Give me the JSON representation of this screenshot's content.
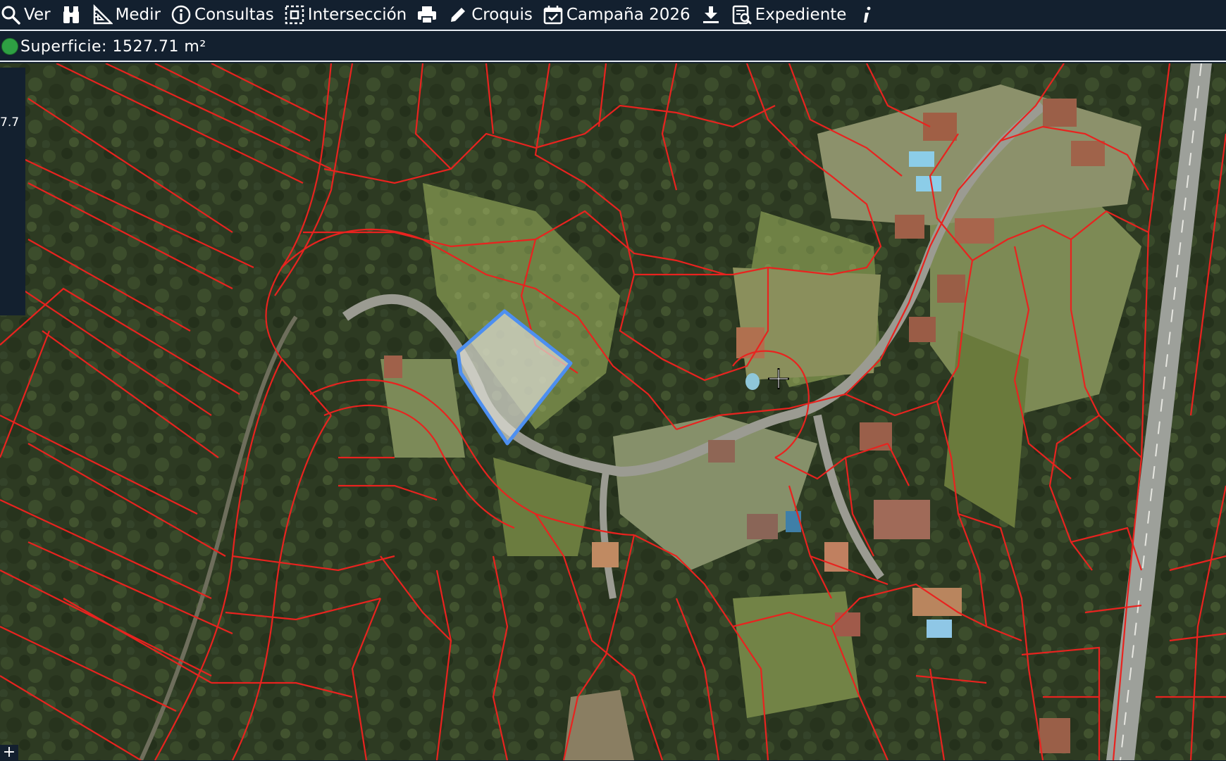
{
  "toolbar": {
    "items": [
      {
        "label": "Ver",
        "icon": "search-icon"
      },
      {
        "label": "",
        "icon": "binoculars-icon"
      },
      {
        "label": "Medir",
        "icon": "ruler-icon"
      },
      {
        "label": "Consultas",
        "icon": "info-icon"
      },
      {
        "label": "Intersección",
        "icon": "intersection-icon"
      },
      {
        "label": "",
        "icon": "printer-icon"
      },
      {
        "label": "Croquis",
        "icon": "pencil-icon"
      },
      {
        "label": "Campaña 2026",
        "icon": "calendar-check-icon"
      },
      {
        "label": "",
        "icon": "download-icon"
      },
      {
        "label": "Expediente",
        "icon": "document-search-icon"
      },
      {
        "label": "",
        "icon": "info-italic-icon"
      }
    ]
  },
  "status": {
    "text": "Superficie: 1527.71 m²",
    "indicator_color": "#2ea043"
  },
  "side_panel": {
    "value": "7.7"
  },
  "map": {
    "parcel_line_color": "#e8231f",
    "selection_color": "#4d8ff0",
    "crosshair_icon": "crosshair-icon"
  },
  "zoom_corner": {
    "label": "+"
  },
  "colors": {
    "bar_background": "#13202f",
    "bar_text": "#ffffff",
    "bar_border": "#e8eef5"
  }
}
